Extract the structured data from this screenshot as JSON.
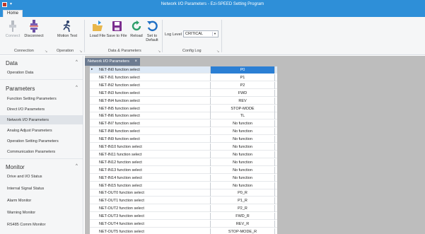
{
  "window": {
    "title": "Network I/O Parameters - Ezi-SPEED Setting Program",
    "dot": "▾"
  },
  "ribbon": {
    "tab": "Home",
    "connect": "Connect",
    "disconnect": "Disconnect",
    "motion_test": "Motion Test",
    "load_file": "Load File",
    "save_to_file": "Save to File",
    "reload": "Reload",
    "set_to_default": "Set to Default",
    "log_level_label": "Log Level",
    "log_level_value": "CRITICAL",
    "groups": {
      "connection": "Connection",
      "operation": "Operation",
      "data_params": "Data & Parameters",
      "config_log": "Config Log"
    }
  },
  "sidebar": {
    "data_header": "Data",
    "operation_data": "Operation Data",
    "parameters_header": "Parameters",
    "param_items": [
      "Function Setting Parameters",
      "Direct I/O Parameters",
      "Network I/O Parameters",
      "Analog Adjust Parameters",
      "Operation Setting Parameters",
      "Communication Parameters"
    ],
    "monitor_header": "Monitor",
    "monitor_items": [
      "Drive and I/O Status",
      "Internal Signal Status",
      "Alarm Monitor",
      "Warning Monitor",
      "RS485 Comm Monitor"
    ],
    "caret": "^"
  },
  "document": {
    "tab_label": "Network I/O Parameters",
    "tab_close": "×",
    "row_indicator": "▸",
    "rows": [
      {
        "label": "NET-IN0 function select",
        "value": "P0"
      },
      {
        "label": "NET-IN1 function select",
        "value": "P1"
      },
      {
        "label": "NET-IN2 function select",
        "value": "P2"
      },
      {
        "label": "NET-IN3 function select",
        "value": "FWD"
      },
      {
        "label": "NET-IN4 function select",
        "value": "REV"
      },
      {
        "label": "NET-IN5 function select",
        "value": "STOP-MODE"
      },
      {
        "label": "NET-IN6 function select",
        "value": "TL"
      },
      {
        "label": "NET-IN7 function select",
        "value": "No function"
      },
      {
        "label": "NET-IN8 function select",
        "value": "No function"
      },
      {
        "label": "NET-IN9 function select",
        "value": "No function"
      },
      {
        "label": "NET-IN10 function select",
        "value": "No function"
      },
      {
        "label": "NET-IN11 function select",
        "value": "No function"
      },
      {
        "label": "NET-IN12 function select",
        "value": "No function"
      },
      {
        "label": "NET-IN13 function select",
        "value": "No function"
      },
      {
        "label": "NET-IN14 function select",
        "value": "No function"
      },
      {
        "label": "NET-IN15 function select",
        "value": "No function"
      },
      {
        "label": "NET-OUT0 function select",
        "value": "P0_R"
      },
      {
        "label": "NET-OUT1 function select",
        "value": "P1_R"
      },
      {
        "label": "NET-OUT2 function select",
        "value": "P2_R"
      },
      {
        "label": "NET-OUT3 function select",
        "value": "FWD_R"
      },
      {
        "label": "NET-OUT4 function select",
        "value": "REV_R"
      },
      {
        "label": "NET-OUT5 function select",
        "value": "STOP-MODE_R"
      }
    ]
  }
}
